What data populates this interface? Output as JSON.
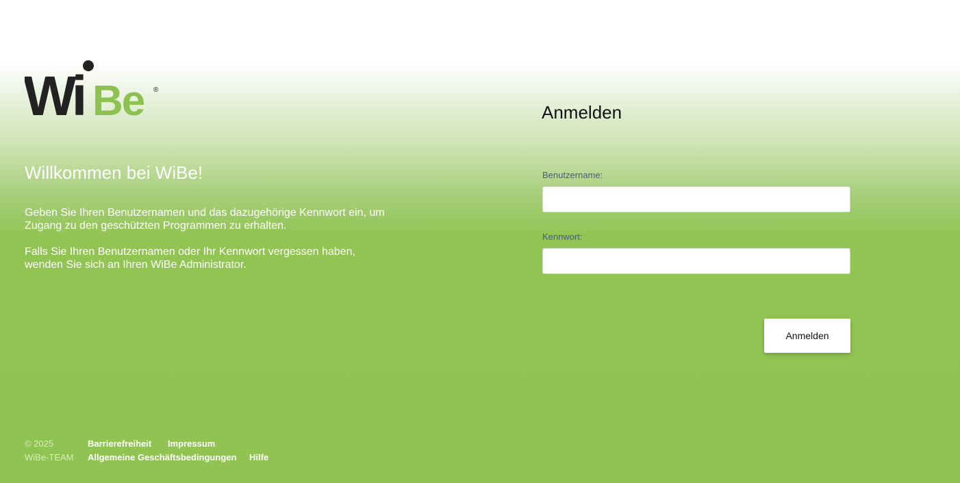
{
  "brand": {
    "logo_text_dark": "Wi",
    "logo_text_green": "Be",
    "logo_mark": "®",
    "colors": {
      "green": "#8dc152",
      "dark": "#222222",
      "background_green": "#91c353"
    }
  },
  "welcome": {
    "title": "Willkommen bei WiBe!",
    "paragraph_1": "Geben Sie Ihren Benutzernamen und das dazugehörige Kennwort ein, um Zugang zu den geschützten Programmen zu erhalten.",
    "paragraph_2": "Falls Sie Ihren Benutzernamen oder Ihr Kennwort vergessen haben, wenden Sie sich an Ihren WiBe Administrator."
  },
  "login": {
    "title": "Anmelden",
    "username_label": "Benutzername:",
    "username_value": "",
    "password_label": "Kennwort:",
    "password_value": "",
    "submit_label": "Anmelden"
  },
  "footer": {
    "copyright": "© 2025",
    "team": "WiBe-TEAM",
    "links": {
      "accessibility": "Barrierefreiheit",
      "imprint": "Impressum",
      "terms": "Allgemeine Geschäftsbedingungen",
      "help": "Hilfe"
    }
  }
}
